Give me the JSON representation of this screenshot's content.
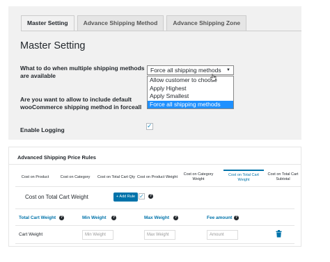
{
  "master": {
    "tabs": [
      {
        "label": "Master Setting",
        "active": true
      },
      {
        "label": "Advance Shipping Method",
        "active": false
      },
      {
        "label": "Advance Shipping Zone",
        "active": false
      }
    ],
    "title": "Master Setting",
    "field1": {
      "label_line1": "What to do when multiple shipping methods",
      "label_line2": "are available",
      "selected": "Force all shipping methods",
      "options": [
        "Allow customer to choose",
        "Apply Highest",
        "Apply Smallest",
        "Force all shipping methods"
      ]
    },
    "field2": {
      "label_line1": "Are you want to allow to include default",
      "label_line2": "wooCommerce shipping method in forceall"
    },
    "field3": {
      "label": "Enable Logging",
      "checked": true
    }
  },
  "rules": {
    "title": "Advanced Shipping Price Rules",
    "tabs": [
      {
        "label": "Cost on Product",
        "active": false
      },
      {
        "label": "Cost on Category",
        "active": false
      },
      {
        "label": "Cost on Total Cart Qty",
        "active": false
      },
      {
        "label": "Cost on Product Weight",
        "active": false
      },
      {
        "label": "Cost on Category Weight",
        "active": false
      },
      {
        "label": "Cost on Total Cart Weight",
        "active": true
      },
      {
        "label": "Cost on Total Cart Subtotal",
        "active": false
      }
    ],
    "section_title": "Cost on Total Cart Weight",
    "add_rule_label": "+ Add Rule",
    "columns": [
      "Total Cart Weight",
      "Min Weight",
      "Max Weight",
      "Fee amount"
    ],
    "row": {
      "label": "Cart Weight",
      "min_placeholder": "Min Weight",
      "max_placeholder": "Max Weight",
      "fee_placeholder": "Amount"
    },
    "help_glyph": "?",
    "accent_color": "#0073aa"
  },
  "icons": {
    "dropdown_arrow": "▼",
    "checkmark": "✓"
  }
}
